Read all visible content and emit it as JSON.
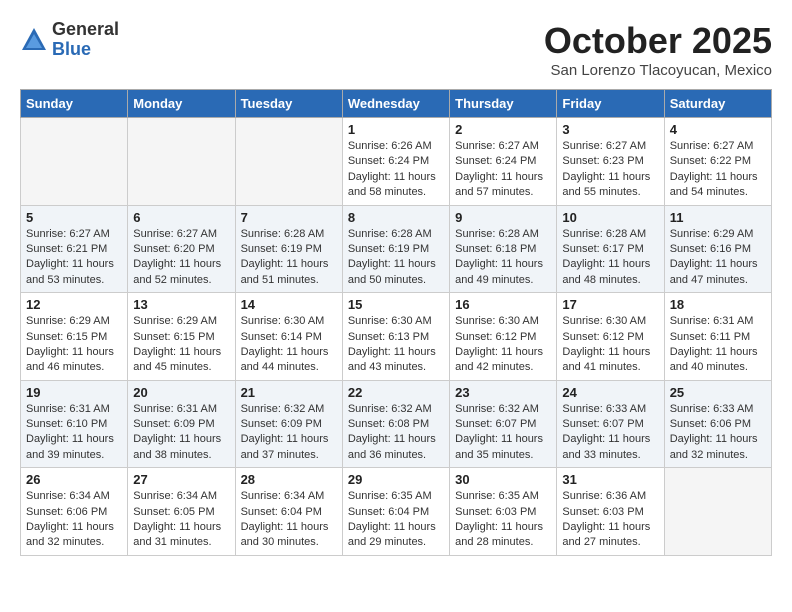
{
  "logo": {
    "general": "General",
    "blue": "Blue"
  },
  "title": "October 2025",
  "location": "San Lorenzo Tlacoyucan, Mexico",
  "weekdays": [
    "Sunday",
    "Monday",
    "Tuesday",
    "Wednesday",
    "Thursday",
    "Friday",
    "Saturday"
  ],
  "rows": [
    [
      {
        "day": "",
        "empty": true
      },
      {
        "day": "",
        "empty": true
      },
      {
        "day": "",
        "empty": true
      },
      {
        "day": "1",
        "sunrise": "6:26 AM",
        "sunset": "6:24 PM",
        "daylight": "11 hours and 58 minutes."
      },
      {
        "day": "2",
        "sunrise": "6:27 AM",
        "sunset": "6:24 PM",
        "daylight": "11 hours and 57 minutes."
      },
      {
        "day": "3",
        "sunrise": "6:27 AM",
        "sunset": "6:23 PM",
        "daylight": "11 hours and 55 minutes."
      },
      {
        "day": "4",
        "sunrise": "6:27 AM",
        "sunset": "6:22 PM",
        "daylight": "11 hours and 54 minutes."
      }
    ],
    [
      {
        "day": "5",
        "sunrise": "6:27 AM",
        "sunset": "6:21 PM",
        "daylight": "11 hours and 53 minutes."
      },
      {
        "day": "6",
        "sunrise": "6:27 AM",
        "sunset": "6:20 PM",
        "daylight": "11 hours and 52 minutes."
      },
      {
        "day": "7",
        "sunrise": "6:28 AM",
        "sunset": "6:19 PM",
        "daylight": "11 hours and 51 minutes."
      },
      {
        "day": "8",
        "sunrise": "6:28 AM",
        "sunset": "6:19 PM",
        "daylight": "11 hours and 50 minutes."
      },
      {
        "day": "9",
        "sunrise": "6:28 AM",
        "sunset": "6:18 PM",
        "daylight": "11 hours and 49 minutes."
      },
      {
        "day": "10",
        "sunrise": "6:28 AM",
        "sunset": "6:17 PM",
        "daylight": "11 hours and 48 minutes."
      },
      {
        "day": "11",
        "sunrise": "6:29 AM",
        "sunset": "6:16 PM",
        "daylight": "11 hours and 47 minutes."
      }
    ],
    [
      {
        "day": "12",
        "sunrise": "6:29 AM",
        "sunset": "6:15 PM",
        "daylight": "11 hours and 46 minutes."
      },
      {
        "day": "13",
        "sunrise": "6:29 AM",
        "sunset": "6:15 PM",
        "daylight": "11 hours and 45 minutes."
      },
      {
        "day": "14",
        "sunrise": "6:30 AM",
        "sunset": "6:14 PM",
        "daylight": "11 hours and 44 minutes."
      },
      {
        "day": "15",
        "sunrise": "6:30 AM",
        "sunset": "6:13 PM",
        "daylight": "11 hours and 43 minutes."
      },
      {
        "day": "16",
        "sunrise": "6:30 AM",
        "sunset": "6:12 PM",
        "daylight": "11 hours and 42 minutes."
      },
      {
        "day": "17",
        "sunrise": "6:30 AM",
        "sunset": "6:12 PM",
        "daylight": "11 hours and 41 minutes."
      },
      {
        "day": "18",
        "sunrise": "6:31 AM",
        "sunset": "6:11 PM",
        "daylight": "11 hours and 40 minutes."
      }
    ],
    [
      {
        "day": "19",
        "sunrise": "6:31 AM",
        "sunset": "6:10 PM",
        "daylight": "11 hours and 39 minutes."
      },
      {
        "day": "20",
        "sunrise": "6:31 AM",
        "sunset": "6:09 PM",
        "daylight": "11 hours and 38 minutes."
      },
      {
        "day": "21",
        "sunrise": "6:32 AM",
        "sunset": "6:09 PM",
        "daylight": "11 hours and 37 minutes."
      },
      {
        "day": "22",
        "sunrise": "6:32 AM",
        "sunset": "6:08 PM",
        "daylight": "11 hours and 36 minutes."
      },
      {
        "day": "23",
        "sunrise": "6:32 AM",
        "sunset": "6:07 PM",
        "daylight": "11 hours and 35 minutes."
      },
      {
        "day": "24",
        "sunrise": "6:33 AM",
        "sunset": "6:07 PM",
        "daylight": "11 hours and 33 minutes."
      },
      {
        "day": "25",
        "sunrise": "6:33 AM",
        "sunset": "6:06 PM",
        "daylight": "11 hours and 32 minutes."
      }
    ],
    [
      {
        "day": "26",
        "sunrise": "6:34 AM",
        "sunset": "6:06 PM",
        "daylight": "11 hours and 32 minutes."
      },
      {
        "day": "27",
        "sunrise": "6:34 AM",
        "sunset": "6:05 PM",
        "daylight": "11 hours and 31 minutes."
      },
      {
        "day": "28",
        "sunrise": "6:34 AM",
        "sunset": "6:04 PM",
        "daylight": "11 hours and 30 minutes."
      },
      {
        "day": "29",
        "sunrise": "6:35 AM",
        "sunset": "6:04 PM",
        "daylight": "11 hours and 29 minutes."
      },
      {
        "day": "30",
        "sunrise": "6:35 AM",
        "sunset": "6:03 PM",
        "daylight": "11 hours and 28 minutes."
      },
      {
        "day": "31",
        "sunrise": "6:36 AM",
        "sunset": "6:03 PM",
        "daylight": "11 hours and 27 minutes."
      },
      {
        "day": "",
        "empty": true
      }
    ]
  ]
}
